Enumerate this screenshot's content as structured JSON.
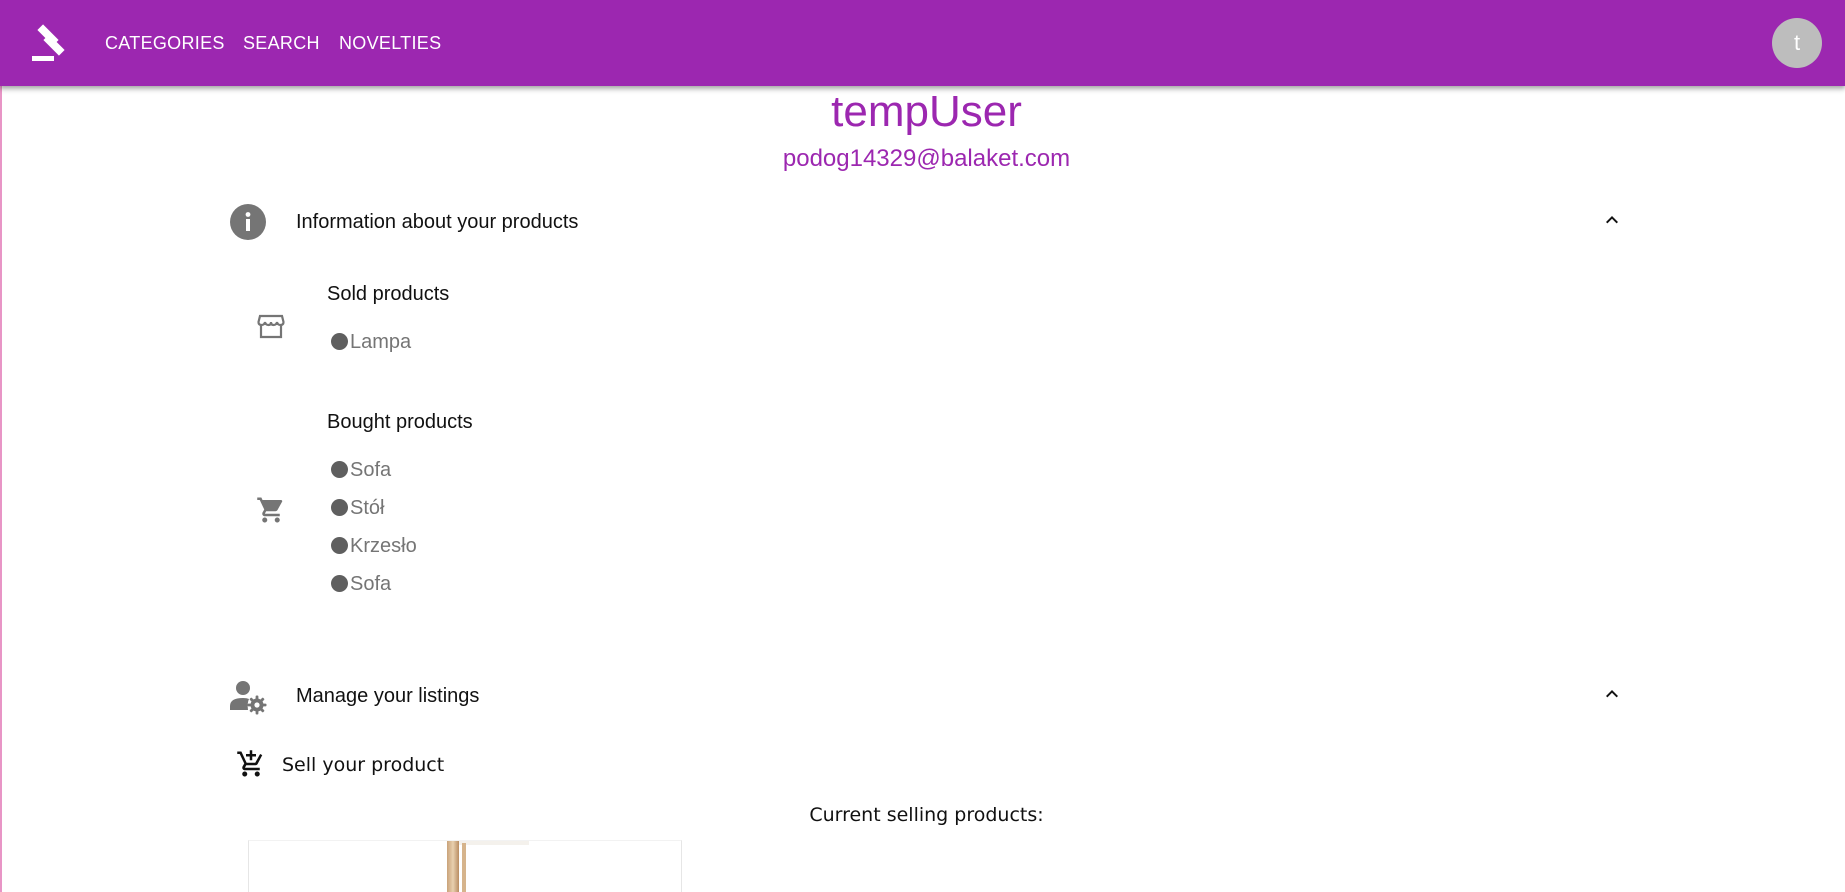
{
  "nav": {
    "items": [
      {
        "label": "CATEGORIES"
      },
      {
        "label": "SEARCH"
      },
      {
        "label": "NOVELTIES"
      }
    ],
    "avatar_initial": "t",
    "brand_color": "#9c27b0"
  },
  "profile": {
    "username": "tempUser",
    "email": "podog14329@balaket.com"
  },
  "info_section": {
    "title": "Information about your products",
    "icon": "info-icon",
    "expanded": true,
    "sold": {
      "title": "Sold products",
      "icon": "storefront-icon",
      "items": [
        "Lampa"
      ]
    },
    "bought": {
      "title": "Bought products",
      "icon": "shopping-cart-icon",
      "items": [
        "Sofa",
        "Stół",
        "Krzesło",
        "Sofa"
      ]
    }
  },
  "listings_section": {
    "title": "Manage your listings",
    "icon": "manage-accounts-icon",
    "expanded": true,
    "sell_label": "Sell your product",
    "current_label": "Current selling products:"
  }
}
